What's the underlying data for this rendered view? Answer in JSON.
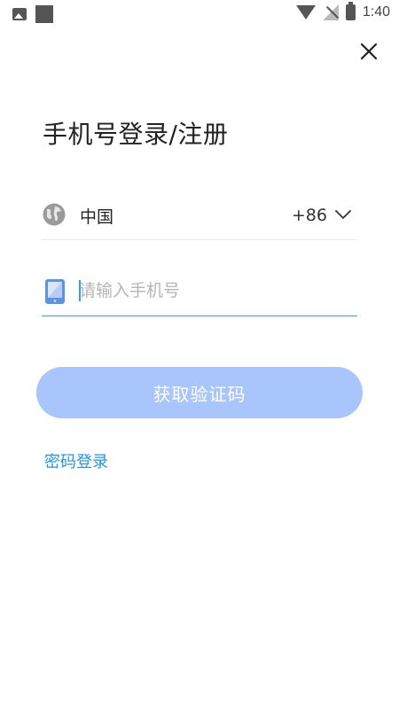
{
  "status_bar": {
    "time": "1:40",
    "icons": [
      "image-icon",
      "square-icon",
      "wifi-icon",
      "signal-off-icon",
      "battery-charging-icon"
    ]
  },
  "close": {
    "icon": "close-icon"
  },
  "title": "手机号登录/注册",
  "country": {
    "icon": "globe-icon",
    "name": "中国",
    "code": "+86",
    "dropdown_icon": "chevron-down-icon"
  },
  "phone": {
    "icon": "phone-icon",
    "placeholder": "请输入手机号",
    "value": ""
  },
  "get_code_button": "获取验证码",
  "password_login_link": "密码登录",
  "colors": {
    "accent": "#3d9be9",
    "button_disabled": "#a8c6fb",
    "link": "#1f96e0"
  }
}
